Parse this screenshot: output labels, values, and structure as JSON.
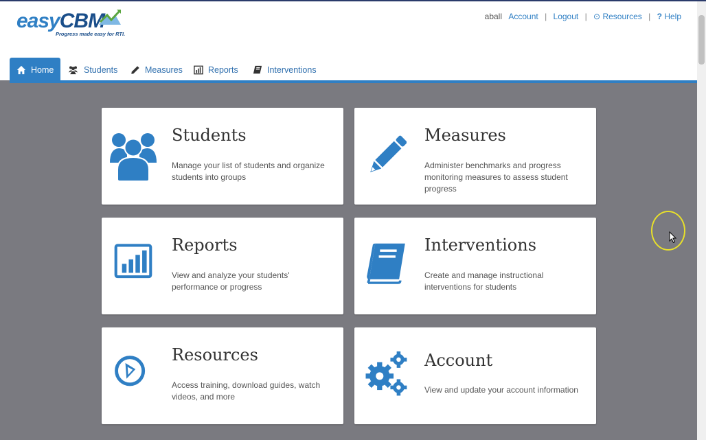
{
  "logo": {
    "text_prefix": "easy",
    "text_main": "CBM",
    "tagline": "Progress made easy for RTI."
  },
  "util_nav": {
    "username": "aball",
    "account": "Account",
    "logout": "Logout",
    "resources": "Resources",
    "help": "Help"
  },
  "tabs": [
    {
      "label": "Home",
      "icon": "home-icon",
      "active": true
    },
    {
      "label": "Students",
      "icon": "users-icon"
    },
    {
      "label": "Measures",
      "icon": "pencil-icon"
    },
    {
      "label": "Reports",
      "icon": "bar-chart-icon"
    },
    {
      "label": "Interventions",
      "icon": "book-icon"
    }
  ],
  "cards": [
    {
      "title": "Students",
      "description": "Manage your list of students and organize students into groups",
      "icon": "users-icon"
    },
    {
      "title": "Measures",
      "description": "Administer benchmarks and progress monitoring measures to assess student progress",
      "icon": "pencil-icon"
    },
    {
      "title": "Reports",
      "description": "View and analyze your students' performance or progress",
      "icon": "bar-chart-icon"
    },
    {
      "title": "Interventions",
      "description": "Create and manage instructional interventions for students",
      "icon": "book-icon"
    },
    {
      "title": "Resources",
      "description": "Access training, download guides, watch videos, and more",
      "icon": "compass-icon"
    },
    {
      "title": "Account",
      "description": "View and update your account information",
      "icon": "gears-icon"
    }
  ],
  "colors": {
    "brand_blue": "#2f7fc4",
    "brand_dark": "#1a4e8a",
    "page_bg": "#7a7a80"
  }
}
